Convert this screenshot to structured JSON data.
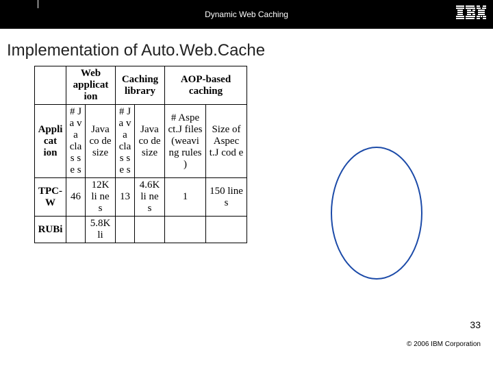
{
  "header": {
    "title": "Dynamic Web Caching",
    "logo": "IBM"
  },
  "slide_title": "Implementation of Auto.Web.Cache",
  "table": {
    "col_groups": {
      "g1": "Web applicat ion",
      "g2": "Caching library",
      "g3": "AOP-based caching"
    },
    "sub_headers": {
      "app": "Appli cat ion",
      "nj1": "# J a v a cla s s e s",
      "cs1": "Java co de size",
      "nj2": "# J a v a cla s s e s",
      "cs2": "Java co de size",
      "nf": "# Aspe ct.J files (weavi ng rules )",
      "sz": "Size of Aspec t.J cod e"
    },
    "rows": [
      {
        "app": "TPC- W",
        "nj1": "46",
        "cs1": "12K li ne s",
        "nj2": "13",
        "cs2": "4.6K li ne s",
        "nf": "1",
        "sz": "150 line s"
      },
      {
        "app": "RUBi",
        "nj1": "",
        "cs1": "5.8K li",
        "nj2": "",
        "cs2": "",
        "nf": "",
        "sz": ""
      }
    ]
  },
  "page_number": "33",
  "copyright": "© 2006 IBM Corporation",
  "colors": {
    "accent": "#1b4aa8"
  }
}
